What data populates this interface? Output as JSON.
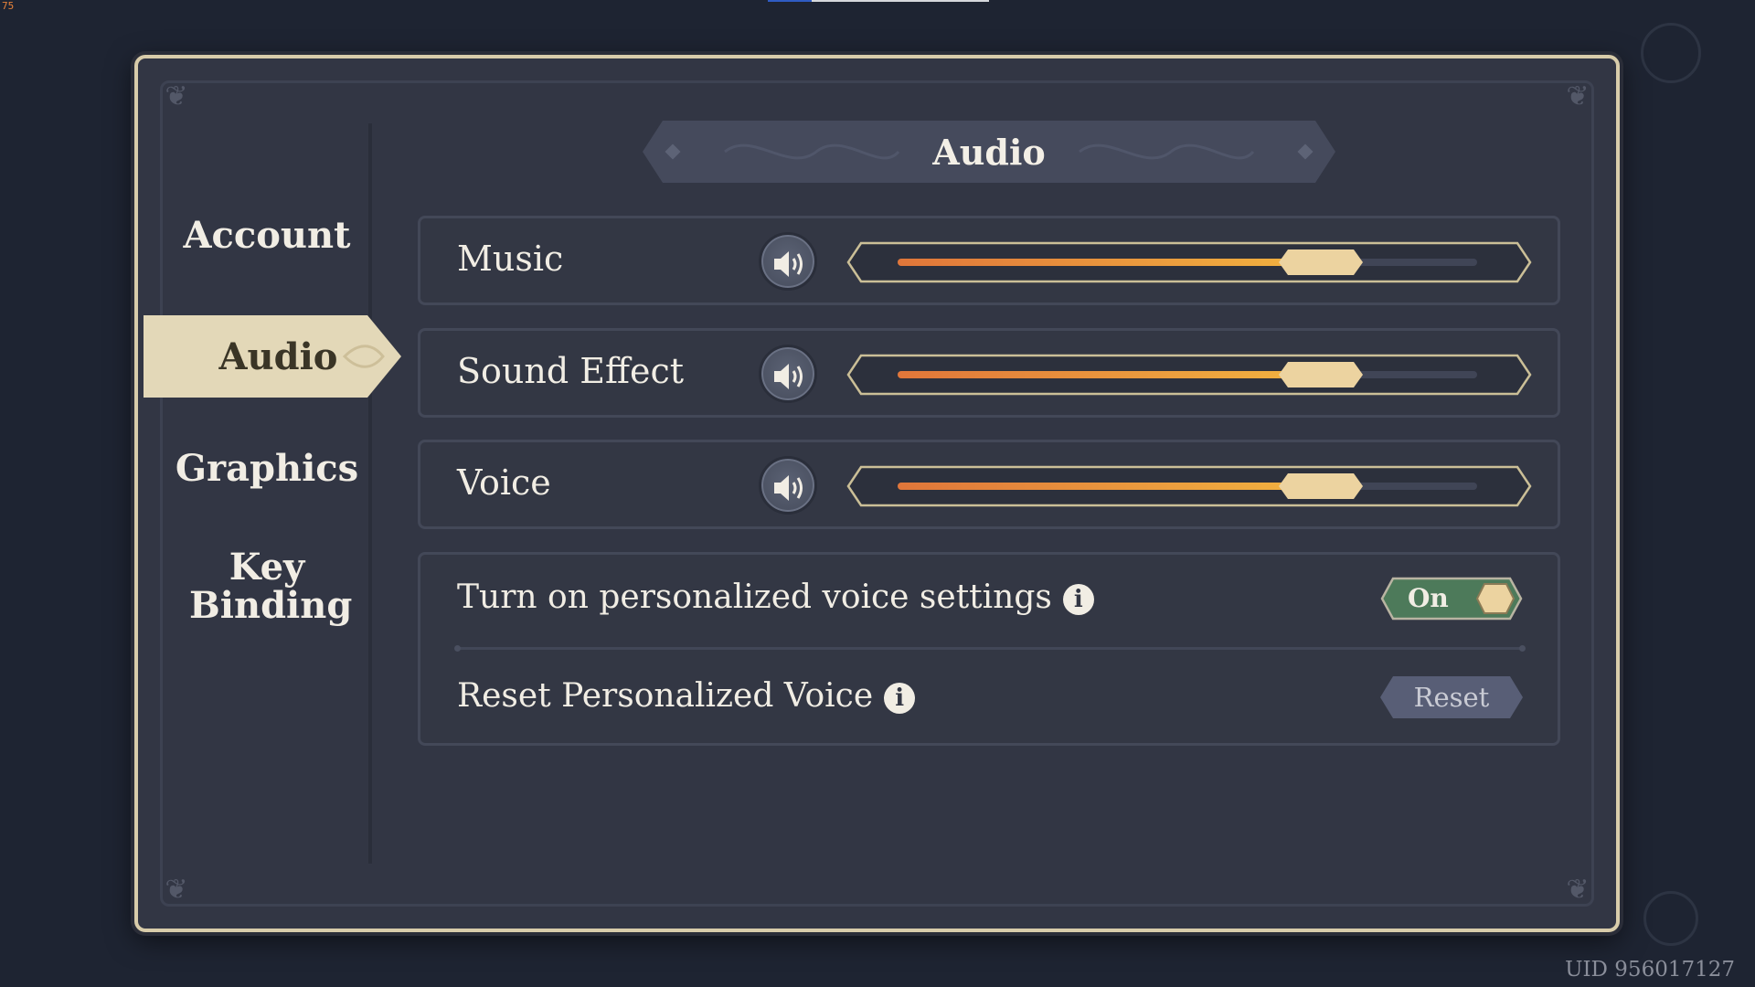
{
  "overlay": {
    "fps_counter": "75"
  },
  "sidebar": {
    "items": [
      {
        "label": "Account",
        "active": false
      },
      {
        "label": "Audio",
        "active": true
      },
      {
        "label": "Graphics",
        "active": false
      },
      {
        "label": "Key Binding",
        "active": false
      }
    ]
  },
  "header": {
    "title": "Audio"
  },
  "volume_rows": [
    {
      "label": "Music",
      "icon": "speaker-icon",
      "level": 0.73
    },
    {
      "label": "Sound Effect",
      "icon": "speaker-icon",
      "level": 0.73
    },
    {
      "label": "Voice",
      "icon": "speaker-icon",
      "level": 0.73
    }
  ],
  "personalized": {
    "toggle_label": "Turn on personalized voice settings",
    "toggle_state": "On",
    "reset_label": "Reset Personalized Voice",
    "reset_button": "Reset",
    "info_icon": "i"
  },
  "footer": {
    "uid": "UID 956017127"
  },
  "colors": {
    "panel_bg": "#323644",
    "frame_gold": "#d8ccaa",
    "slider_fill_start": "#e0763a",
    "slider_fill_end": "#f2b440",
    "thumb": "#ecd3a0",
    "toggle_on": "#4d7a5a",
    "active_tab": "#e3d8b8"
  }
}
